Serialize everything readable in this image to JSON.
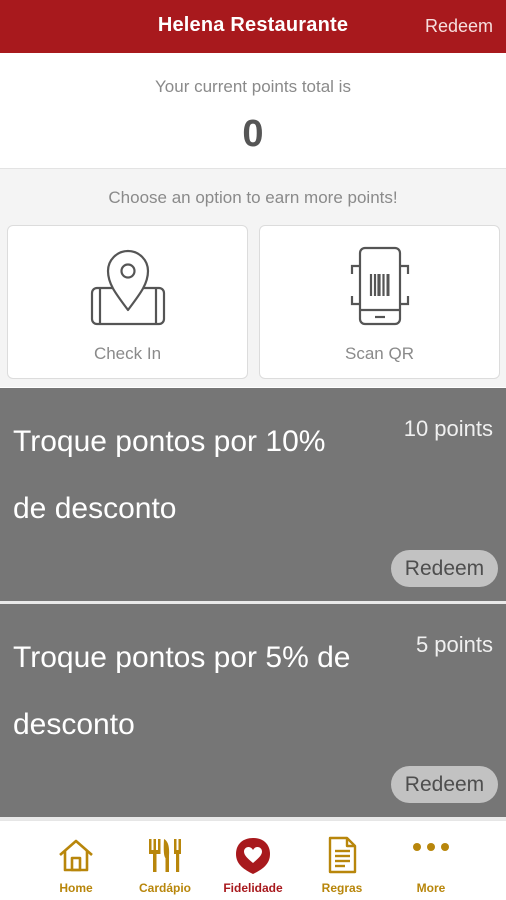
{
  "header": {
    "title": "Helena Restaurante",
    "redeem_label": "Redeem"
  },
  "points": {
    "caption": "Your current points total is",
    "value": "0"
  },
  "earn": {
    "caption": "Choose an option to earn more points!",
    "options": [
      {
        "label": "Check In",
        "icon": "phone-location-pin-icon"
      },
      {
        "label": "Scan QR",
        "icon": "phone-barcode-scan-icon"
      }
    ]
  },
  "rewards": [
    {
      "title": "Troque pontos por 10% de desconto",
      "points": "10 points",
      "button": "Redeem"
    },
    {
      "title": "Troque pontos por 5% de desconto",
      "points": "5 points",
      "button": "Redeem"
    }
  ],
  "tabbar": {
    "tabs": [
      {
        "label": "Home",
        "icon": "home-icon"
      },
      {
        "label": "Cardápio",
        "icon": "cutlery-icon"
      },
      {
        "label": "Fidelidade",
        "icon": "heart-icon",
        "active": true
      },
      {
        "label": "Regras",
        "icon": "document-icon"
      },
      {
        "label": "More",
        "icon": "more-dots-icon"
      }
    ]
  },
  "colors": {
    "brand": "#a8191d",
    "tab_gold": "#b8860b",
    "reward_bg": "#767676"
  }
}
